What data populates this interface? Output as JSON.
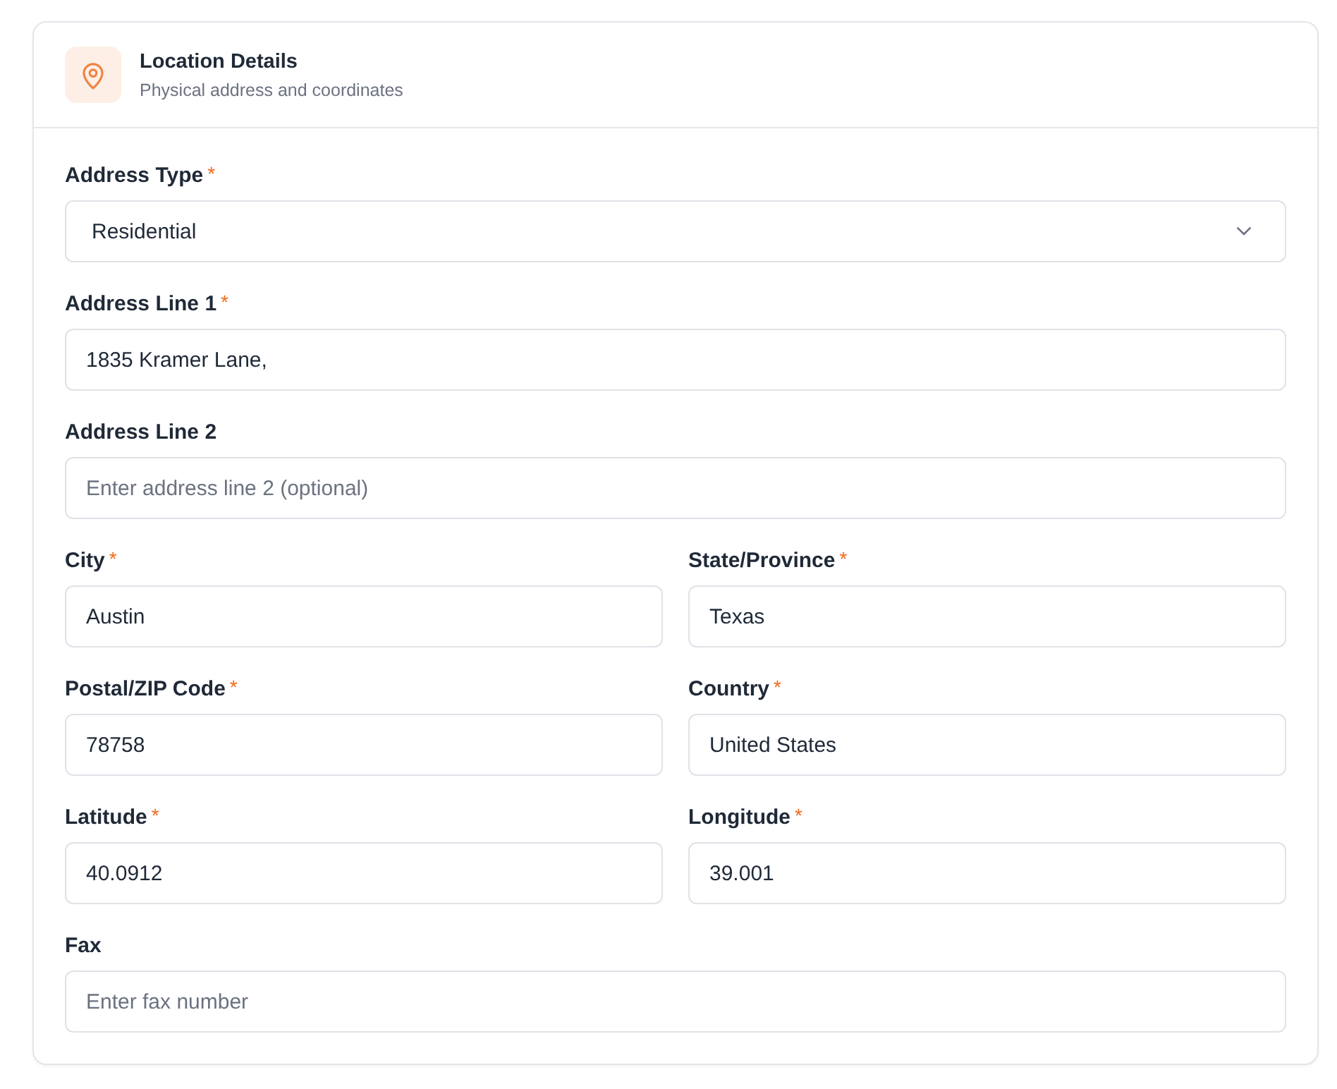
{
  "card": {
    "title": "Location Details",
    "subtitle": "Physical address and coordinates"
  },
  "rows": [
    {
      "fields": [
        {
          "kind": "select",
          "label": "Address Type",
          "required_mark": "*",
          "value": "Residential"
        }
      ]
    },
    {
      "fields": [
        {
          "kind": "text",
          "label": "Address Line 1",
          "required_mark": "*",
          "value": "1835 Kramer Lane,"
        }
      ]
    },
    {
      "fields": [
        {
          "kind": "text",
          "label": "Address Line 2",
          "placeholder": "Enter address line 2 (optional)"
        }
      ]
    },
    {
      "fields": [
        {
          "kind": "text",
          "label": "City",
          "required_mark": "*",
          "value": "Austin"
        },
        {
          "kind": "text",
          "label": "State/Province",
          "required_mark": "*",
          "value": "Texas"
        }
      ]
    },
    {
      "fields": [
        {
          "kind": "text",
          "label": "Postal/ZIP Code",
          "required_mark": "*",
          "value": "78758"
        },
        {
          "kind": "text",
          "label": "Country",
          "required_mark": "*",
          "value": "United States"
        }
      ]
    },
    {
      "fields": [
        {
          "kind": "text",
          "label": "Latitude",
          "required_mark": "*",
          "value": "40.0912"
        },
        {
          "kind": "text",
          "label": "Longitude",
          "required_mark": "*",
          "value": "39.001"
        }
      ]
    },
    {
      "fields": [
        {
          "kind": "text",
          "label": "Fax",
          "placeholder": "Enter fax number"
        }
      ]
    }
  ]
}
